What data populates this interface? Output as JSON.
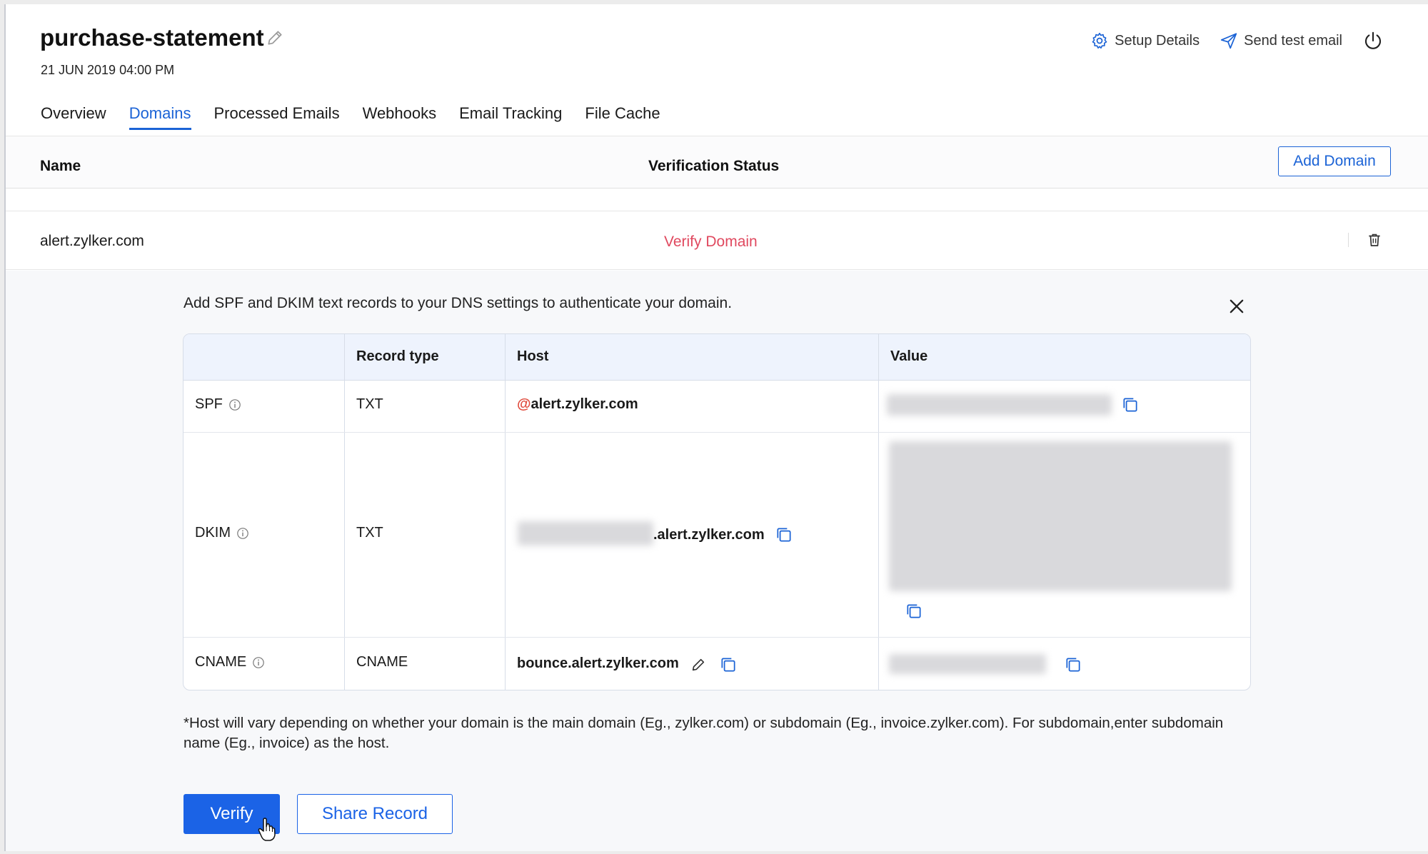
{
  "header": {
    "title": "purchase-statement",
    "timestamp": "21 JUN 2019 04:00 PM",
    "actions": {
      "setup_details": "Setup Details",
      "send_test_email": "Send test email"
    }
  },
  "tabs": [
    {
      "label": "Overview",
      "active": false
    },
    {
      "label": "Domains",
      "active": true
    },
    {
      "label": "Processed Emails",
      "active": false
    },
    {
      "label": "Webhooks",
      "active": false
    },
    {
      "label": "Email Tracking",
      "active": false
    },
    {
      "label": "File Cache",
      "active": false
    }
  ],
  "list": {
    "col_name": "Name",
    "col_status": "Verification Status",
    "add_domain_label": "Add Domain",
    "row": {
      "domain": "alert.zylker.com",
      "status_action": "Verify Domain"
    }
  },
  "dns_panel": {
    "intro": "Add SPF and DKIM text records to your DNS settings to authenticate your domain.",
    "columns": {
      "type": "Record type",
      "host": "Host",
      "value": "Value"
    },
    "records": [
      {
        "name": "SPF",
        "type": "TXT",
        "host_prefix": "@",
        "host": "alert.zylker.com"
      },
      {
        "name": "DKIM",
        "type": "TXT",
        "host": ".alert.zylker.com"
      },
      {
        "name": "CNAME",
        "type": "CNAME",
        "host": "bounce.alert.zylker.com"
      }
    ],
    "footnote": "*Host will vary depending on whether your domain is the main domain (Eg., zylker.com) or subdomain (Eg., invoice.zylker.com). For subdomain,enter subdomain name (Eg., invoice) as the host.",
    "verify_label": "Verify",
    "share_label": "Share Record"
  },
  "colors": {
    "accent": "#1b63e6",
    "danger": "#e0495f",
    "panel_bg": "#f7f8fa",
    "table_header_bg": "#eef3fd"
  }
}
